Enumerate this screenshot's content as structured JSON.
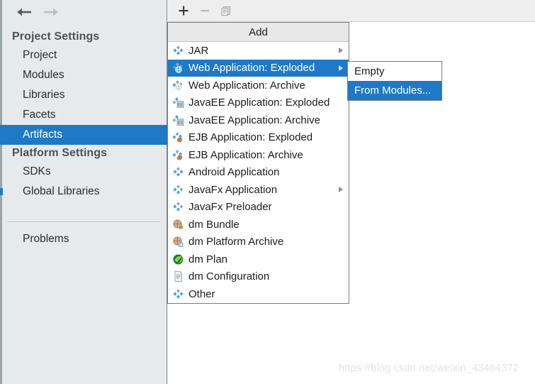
{
  "colors": {
    "selection_blue": "#1f79c7",
    "sidebar_bg": "#e6eaed",
    "menu_bg": "#ffffff",
    "menu_header_bg": "#e8e8e8",
    "right_pane_bg": "#f2f2f2",
    "toolbar_bg": "#eeeeee",
    "watermark": "#e2e2e2"
  },
  "nav": {
    "back_icon": "arrow-left-icon",
    "forward_icon": "arrow-right-icon",
    "back_enabled": true,
    "forward_enabled": false
  },
  "sidebar": {
    "groups": [
      {
        "title": "Project Settings",
        "items": [
          {
            "label": "Project",
            "selected": false
          },
          {
            "label": "Modules",
            "selected": false
          },
          {
            "label": "Libraries",
            "selected": false
          },
          {
            "label": "Facets",
            "selected": false
          },
          {
            "label": "Artifacts",
            "selected": true
          }
        ]
      },
      {
        "title": "Platform Settings",
        "items": [
          {
            "label": "SDKs",
            "selected": false
          },
          {
            "label": "Global Libraries",
            "selected": false
          }
        ]
      }
    ],
    "extra": {
      "label": "Problems",
      "selected": false
    }
  },
  "toolbar": {
    "buttons": [
      {
        "name": "add-button",
        "icon": "plus-icon",
        "glyph": "+",
        "enabled": true
      },
      {
        "name": "remove-button",
        "icon": "minus-icon",
        "glyph": "−",
        "enabled": false
      },
      {
        "name": "duplicate-button",
        "icon": "copy-icon",
        "glyph": "",
        "enabled": false
      }
    ]
  },
  "add_menu": {
    "title": "Add",
    "items": [
      {
        "label": "JAR",
        "icon": "jar-icon",
        "selected": false,
        "submenu": true
      },
      {
        "label": "Web Application: Exploded",
        "icon": "web-app-icon",
        "selected": true,
        "submenu": true
      },
      {
        "label": "Web Application: Archive",
        "icon": "web-app-icon",
        "selected": false,
        "submenu": false
      },
      {
        "label": "JavaEE Application: Exploded",
        "icon": "javaee-app-icon",
        "selected": false,
        "submenu": false
      },
      {
        "label": "JavaEE Application: Archive",
        "icon": "javaee-app-icon",
        "selected": false,
        "submenu": false
      },
      {
        "label": "EJB Application: Exploded",
        "icon": "ejb-app-icon",
        "selected": false,
        "submenu": false
      },
      {
        "label": "EJB Application: Archive",
        "icon": "ejb-app-icon",
        "selected": false,
        "submenu": false
      },
      {
        "label": "Android Application",
        "icon": "android-app-icon",
        "selected": false,
        "submenu": false
      },
      {
        "label": "JavaFx Application",
        "icon": "javafx-app-icon",
        "selected": false,
        "submenu": true
      },
      {
        "label": "JavaFx Preloader",
        "icon": "javafx-preloader-icon",
        "selected": false,
        "submenu": false
      },
      {
        "label": "dm Bundle",
        "icon": "dm-bundle-icon",
        "selected": false,
        "submenu": false
      },
      {
        "label": "dm Platform Archive",
        "icon": "dm-platform-icon",
        "selected": false,
        "submenu": false
      },
      {
        "label": "dm Plan",
        "icon": "dm-plan-icon",
        "selected": false,
        "submenu": false
      },
      {
        "label": "dm Configuration",
        "icon": "dm-config-icon",
        "selected": false,
        "submenu": false
      },
      {
        "label": "Other",
        "icon": "other-icon",
        "selected": false,
        "submenu": false
      }
    ]
  },
  "submenu": {
    "items": [
      {
        "label": "Empty",
        "selected": false
      },
      {
        "label": "From Modules...",
        "selected": true
      }
    ]
  },
  "watermark": {
    "text": "https://blog.csdn.net/weixin_43464372"
  }
}
